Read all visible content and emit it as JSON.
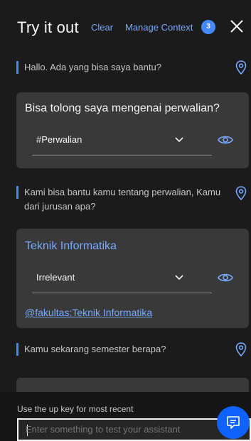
{
  "header": {
    "title": "Try it out",
    "clear_label": "Clear",
    "manage_context_label": "Manage Context",
    "context_count": "3"
  },
  "messages": {
    "bot_1": "Hallo. Ada yang bisa saya bantu?",
    "user_1": {
      "text": "Bisa tolong saya mengenai perwalian?",
      "intent": "#Perwalian"
    },
    "bot_2": "Kami bisa bantu kamu tentang perwalian, Kamu dari jurusan apa?",
    "user_2": {
      "text": "Teknik Informatika",
      "intent": "Irrelevant",
      "entity": "@fakultas:Teknik Informatika"
    },
    "bot_3": "Kamu sekarang semester berapa?"
  },
  "footer": {
    "hint": "Use the up key for most recent",
    "input_placeholder": "Enter something to test your assistant"
  },
  "colors": {
    "background": "#1b1b1b",
    "card": "#393939",
    "accent": "#78a9ff",
    "send_button": "#0f62fe"
  },
  "icons": [
    "close-icon",
    "location-pin-icon",
    "chevron-down-icon",
    "eye-icon",
    "chat-icon"
  ]
}
